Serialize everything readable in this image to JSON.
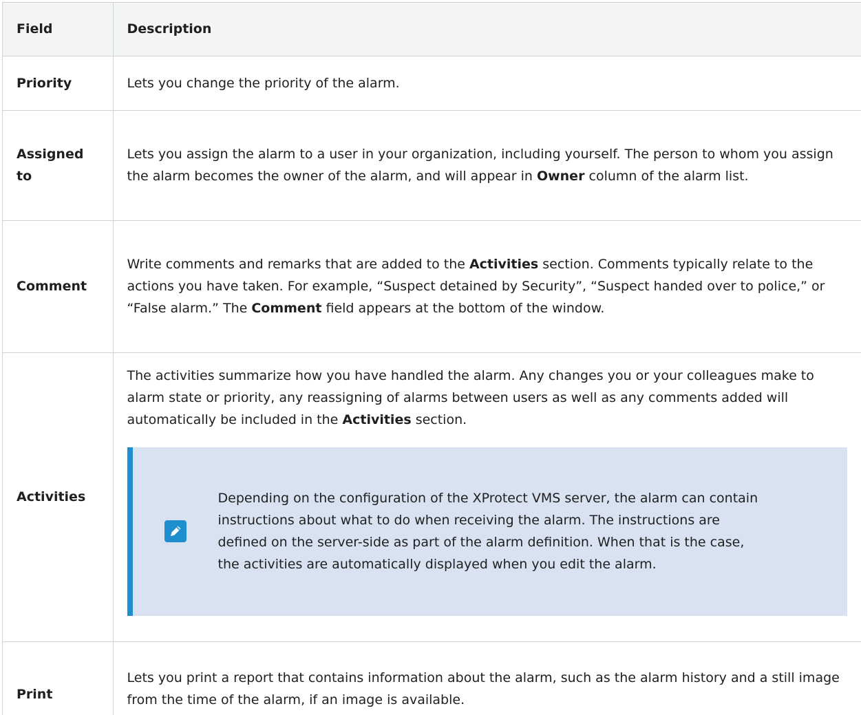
{
  "table": {
    "headers": {
      "field": "Field",
      "description": "Description"
    },
    "rows": {
      "priority": {
        "field": "Priority",
        "desc": "Lets you change the priority of the alarm."
      },
      "assigned": {
        "field": "Assigned to",
        "desc_1": "Lets you assign the alarm to a user in your organization, including yourself. The person to whom you assign the alarm becomes the owner of the alarm, and will appear in ",
        "desc_bold": "Owner",
        "desc_2": " column of the alarm list."
      },
      "comment": {
        "field": "Comment",
        "desc_1": "Write comments and remarks that are added to the ",
        "desc_bold_1": "Activities",
        "desc_2": " section. Comments typically relate to the actions you have taken. For example, “Suspect detained by Security”, “Suspect handed over to police,” or “False alarm.” The ",
        "desc_bold_2": "Comment",
        "desc_3": " field appears at the bottom of the window."
      },
      "activities": {
        "field": "Activities",
        "desc_1": "The activities summarize how you have handled the alarm. Any changes you or your colleagues make to alarm state or priority, any reassigning of alarms between users as well as any comments added will automatically be included in the ",
        "desc_bold": "Activities",
        "desc_2": " section.",
        "note": {
          "icon": "pencil-icon",
          "text": "Depending on the configuration of the XProtect VMS server, the alarm can contain instructions about what to do when receiving the alarm. The instructions are defined on the server-side as part of the alarm definition. When that is the case, the activities are automatically displayed when you edit the alarm."
        }
      },
      "print": {
        "field": "Print",
        "desc": "Lets you print a report that contains information about the alarm, such as the alarm history and a still image from the time of the alarm, if an image is available."
      }
    }
  },
  "colors": {
    "note_background": "#d8e2f1",
    "note_accent": "#1e8ecf",
    "header_background": "#f3f4f4",
    "border": "#cfd3d6"
  }
}
